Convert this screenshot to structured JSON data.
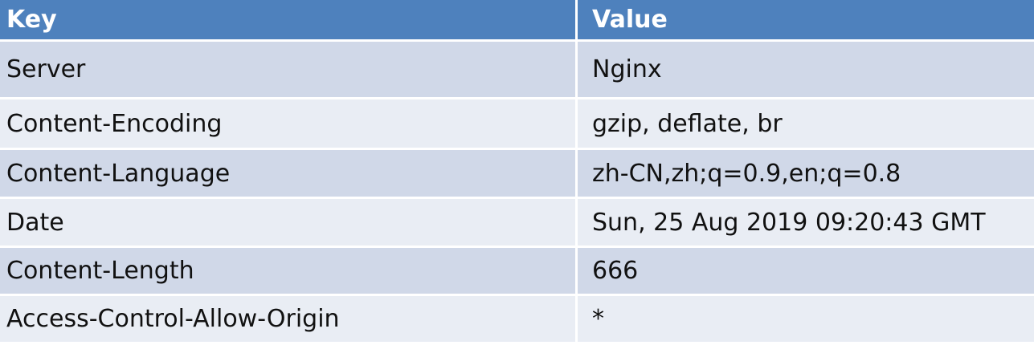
{
  "header": {
    "key_label": "Key",
    "value_label": "Value"
  },
  "rows": [
    {
      "key": "Server",
      "value": "Nginx"
    },
    {
      "key": "Content-Encoding",
      "value": "gzip, deflate, br"
    },
    {
      "key": "Content-Language",
      "value": "zh-CN,zh;q=0.9,en;q=0.8"
    },
    {
      "key": "Date",
      "value": "Sun, 25 Aug 2019 09:20:43 GMT"
    },
    {
      "key": "Content-Length",
      "value": "666"
    },
    {
      "key": "Access-Control-Allow-Origin",
      "value": "*"
    }
  ],
  "colors": {
    "header_bg": "#4e81bd",
    "row_odd_bg": "#d0d8e8",
    "row_even_bg": "#e9edf4"
  }
}
